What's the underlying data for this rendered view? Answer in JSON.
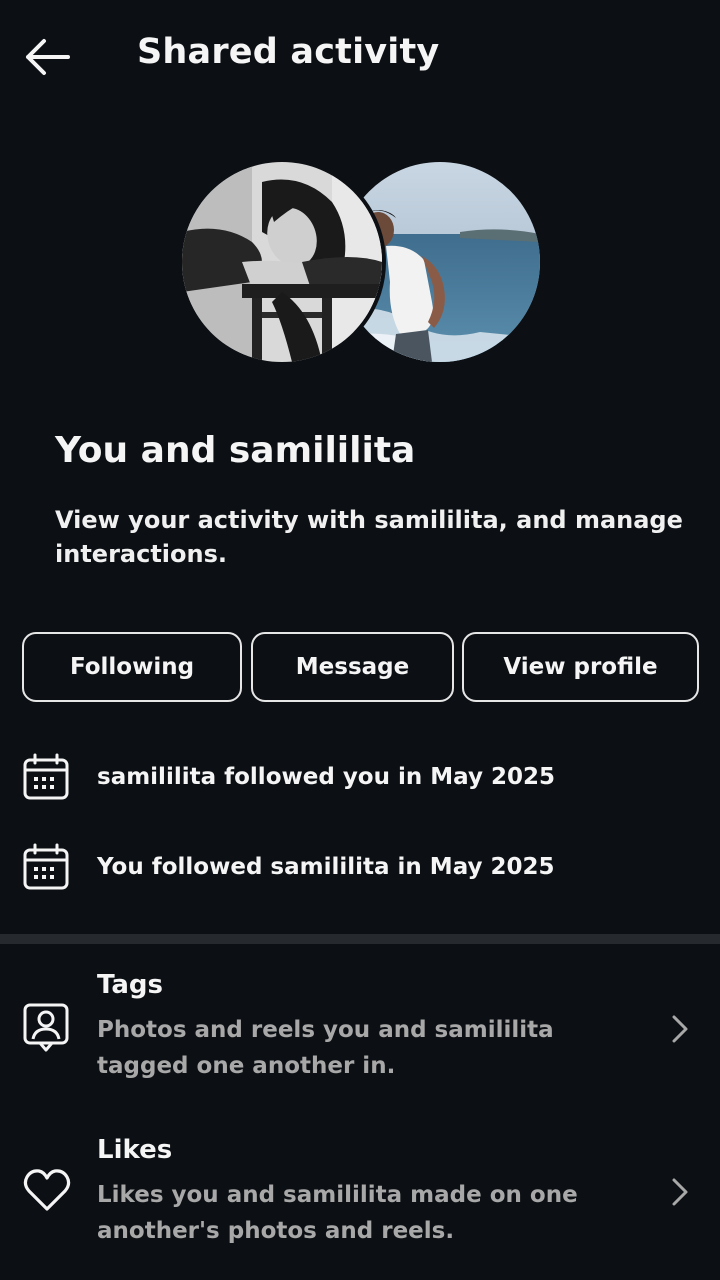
{
  "header": {
    "title": "Shared activity",
    "back_icon": "arrow-left-icon"
  },
  "profile": {
    "title": "You and samililita",
    "description": "View your activity with samililita, and manage interactions."
  },
  "buttons": {
    "following": "Following",
    "message": "Message",
    "view_profile": "View profile"
  },
  "activity": [
    {
      "icon": "calendar-icon",
      "text": "samililita followed you in May 2025"
    },
    {
      "icon": "calendar-icon",
      "text": "You followed samililita in May 2025"
    }
  ],
  "sections": [
    {
      "icon": "tag-person-icon",
      "label": "Tags",
      "description": "Photos and reels you and samililita tagged one another in."
    },
    {
      "icon": "heart-icon",
      "label": "Likes",
      "description": "Likes you and samililita made on one another's photos and reels."
    }
  ],
  "colors": {
    "background": "#0c1014",
    "text": "#f5f5f5",
    "secondary_text": "#a8a8a8",
    "divider": "#262a2e"
  }
}
